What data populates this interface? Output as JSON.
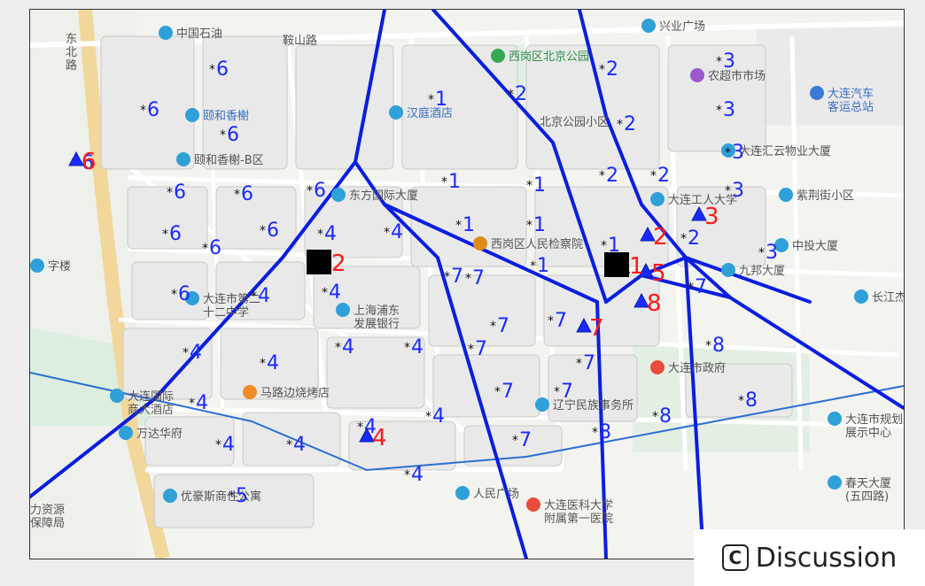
{
  "map": {
    "place_labels": [
      {
        "text": "中国石油",
        "icon": "poi-pin-icon"
      },
      {
        "text": "鞍山路",
        "icon": ""
      },
      {
        "text": "东\n北\n路",
        "icon": ""
      },
      {
        "text": "兴业广场",
        "icon": "poi-pin-icon"
      },
      {
        "text": "西岗区北京公园",
        "icon": "park-icon"
      },
      {
        "text": "农超市市场",
        "icon": "shop-icon"
      },
      {
        "text": "大连汽车\n客运总站",
        "icon": "bus-icon"
      },
      {
        "text": "颐和香榭",
        "icon": "poi-pin-icon"
      },
      {
        "text": "汉庭酒店",
        "icon": "hotel-icon"
      },
      {
        "text": "北京公园小区",
        "icon": ""
      },
      {
        "text": "颐和香榭-B区",
        "icon": "poi-pin-icon"
      },
      {
        "text": "大连汇云物业大厦",
        "icon": "poi-pin-icon"
      },
      {
        "text": "东方国际大厦",
        "icon": "poi-pin-icon"
      },
      {
        "text": "大连工人大学",
        "icon": "poi-pin-icon"
      },
      {
        "text": "紫荆街小区",
        "icon": "poi-pin-icon"
      },
      {
        "text": "西岗区人民检察院",
        "icon": "gov-icon"
      },
      {
        "text": "字楼",
        "icon": "poi-pin-icon"
      },
      {
        "text": "中投大厦",
        "icon": "poi-pin-icon"
      },
      {
        "text": "九邦大厦",
        "icon": "poi-pin-icon"
      },
      {
        "text": "长江杰座",
        "icon": "poi-pin-icon"
      },
      {
        "text": "大连市第二\n十二中学",
        "icon": "school-icon"
      },
      {
        "text": "上海浦东\n发展银行",
        "icon": "bank-icon"
      },
      {
        "text": "大连市政府",
        "icon": "gov-star-icon"
      },
      {
        "text": "马路边烧烤店",
        "icon": "food-icon"
      },
      {
        "text": "万达华府",
        "icon": "poi-pin-icon"
      },
      {
        "text": "辽宁民族事务所",
        "icon": "poi-pin-icon"
      },
      {
        "text": "人民广场",
        "icon": "metro-icon"
      },
      {
        "text": "大连市规划\n展示中心",
        "icon": "poi-pin-icon"
      },
      {
        "text": "春天大厦\n(五四路)",
        "icon": "poi-pin-icon"
      },
      {
        "text": "大连医科大学\n附属第一医院",
        "icon": "hospital-icon"
      },
      {
        "text": "力资源\n保障局",
        "icon": ""
      },
      {
        "text": "优豪斯商住公寓",
        "icon": "poi-pin-icon"
      },
      {
        "text": "大连国际\n商大酒店",
        "icon": "poi-pin-icon"
      }
    ],
    "nodes": [
      {
        "label": "6",
        "kind": "blue"
      },
      {
        "label": "6",
        "kind": "blue"
      },
      {
        "label": "6",
        "kind": "blue"
      },
      {
        "label": "6",
        "kind": "blue"
      },
      {
        "label": "6",
        "kind": "blue"
      },
      {
        "label": "6",
        "kind": "blue"
      },
      {
        "label": "6",
        "kind": "blue"
      },
      {
        "label": "6",
        "kind": "blue"
      },
      {
        "label": "6",
        "kind": "blue"
      },
      {
        "label": "6",
        "kind": "blue"
      },
      {
        "label": "6",
        "kind": "blue"
      },
      {
        "label": "1",
        "kind": "blue"
      },
      {
        "label": "1",
        "kind": "blue"
      },
      {
        "label": "1",
        "kind": "blue"
      },
      {
        "label": "1",
        "kind": "blue"
      },
      {
        "label": "1",
        "kind": "blue"
      },
      {
        "label": "1",
        "kind": "blue"
      },
      {
        "label": "1",
        "kind": "blue"
      },
      {
        "label": "2",
        "kind": "blue"
      },
      {
        "label": "2",
        "kind": "blue"
      },
      {
        "label": "2",
        "kind": "blue"
      },
      {
        "label": "2",
        "kind": "blue"
      },
      {
        "label": "2",
        "kind": "blue"
      },
      {
        "label": "2",
        "kind": "blue"
      },
      {
        "label": "3",
        "kind": "blue"
      },
      {
        "label": "3",
        "kind": "blue"
      },
      {
        "label": "3",
        "kind": "blue"
      },
      {
        "label": "3",
        "kind": "blue"
      },
      {
        "label": "3",
        "kind": "blue"
      },
      {
        "label": "4",
        "kind": "blue"
      },
      {
        "label": "4",
        "kind": "blue"
      },
      {
        "label": "4",
        "kind": "blue"
      },
      {
        "label": "4",
        "kind": "blue"
      },
      {
        "label": "4",
        "kind": "blue"
      },
      {
        "label": "4",
        "kind": "blue"
      },
      {
        "label": "4",
        "kind": "blue"
      },
      {
        "label": "4",
        "kind": "blue"
      },
      {
        "label": "4",
        "kind": "blue"
      },
      {
        "label": "4",
        "kind": "blue"
      },
      {
        "label": "4",
        "kind": "blue"
      },
      {
        "label": "4",
        "kind": "blue"
      },
      {
        "label": "4",
        "kind": "blue"
      },
      {
        "label": "4",
        "kind": "blue"
      },
      {
        "label": "5",
        "kind": "blue"
      },
      {
        "label": "7",
        "kind": "blue"
      },
      {
        "label": "7",
        "kind": "blue"
      },
      {
        "label": "7",
        "kind": "blue"
      },
      {
        "label": "7",
        "kind": "blue"
      },
      {
        "label": "7",
        "kind": "blue"
      },
      {
        "label": "7",
        "kind": "blue"
      },
      {
        "label": "7",
        "kind": "blue"
      },
      {
        "label": "7",
        "kind": "blue"
      },
      {
        "label": "7",
        "kind": "blue"
      },
      {
        "label": "7",
        "kind": "blue"
      },
      {
        "label": "8",
        "kind": "blue"
      },
      {
        "label": "8",
        "kind": "blue"
      },
      {
        "label": "8",
        "kind": "blue"
      },
      {
        "label": "8",
        "kind": "blue"
      }
    ],
    "facilities": [
      {
        "label": "6",
        "kind": "triangle"
      },
      {
        "label": "3",
        "kind": "triangle"
      },
      {
        "label": "2",
        "kind": "triangle"
      },
      {
        "label": "1",
        "kind": "triangle"
      },
      {
        "label": "5",
        "kind": "triangle"
      },
      {
        "label": "8",
        "kind": "triangle"
      },
      {
        "label": "7",
        "kind": "triangle"
      },
      {
        "label": "4",
        "kind": "triangle"
      },
      {
        "label": "2",
        "kind": "square"
      },
      {
        "label": "1",
        "kind": "square"
      }
    ],
    "boundary_color": "#0a1ee0",
    "facility_label_color": "#ff1a1a",
    "node_label_color": "#1a2aff"
  },
  "badge": {
    "icon": "c-icon",
    "glyph": "C",
    "label": "Discussion"
  }
}
